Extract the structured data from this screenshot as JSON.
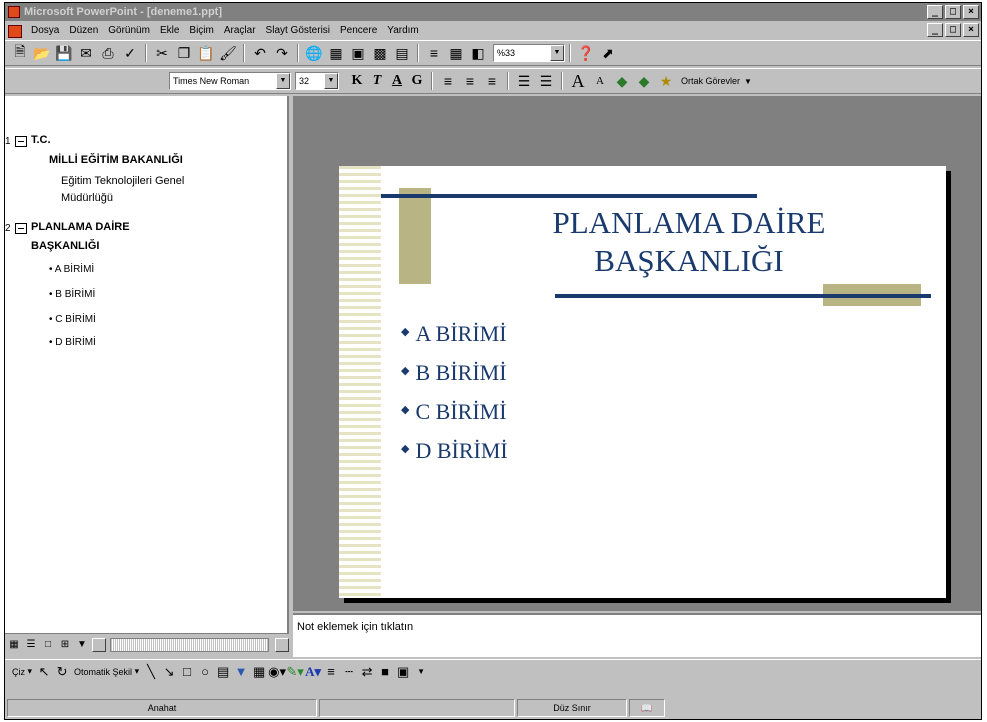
{
  "window": {
    "title": "Microsoft PowerPoint - [deneme1.ppt]",
    "minimize": "_",
    "restore": "ð",
    "close": "×"
  },
  "menu": [
    "Dosya",
    "Düzen",
    "Görünüm",
    "Ekle",
    "Biçim",
    "Araçlar",
    "Slayt Gösterisi",
    "Pencere",
    "Yardım"
  ],
  "toolbar": {
    "zoom": "%33",
    "font": "Times New Roman",
    "size": "32",
    "bold": "K",
    "italic": "T",
    "underline": "A",
    "shadow": "G",
    "tasks": "Ortak Görevler"
  },
  "outline": {
    "slides": [
      {
        "number": "1",
        "title1": "T.C.",
        "title2": "MİLLİ EĞİTİM BAKANLIĞI",
        "sub1": "Eğitim Teknolojileri Genel",
        "sub2": "Müdürlüğü"
      },
      {
        "number": "2",
        "title1": "PLANLAMA DAİRE",
        "title2": "BAŞKANLIĞI",
        "bullets": [
          "A BİRİMİ",
          "B BİRİMİ",
          "C BİRİMİ",
          "D BİRİMİ"
        ]
      }
    ]
  },
  "slide": {
    "title1": "PLANLAMA DAİRE",
    "title2": "BAŞKANLIĞI",
    "bullets": [
      "A BİRİMİ",
      "B BİRİMİ",
      "C BİRİMİ",
      "D BİRİMİ"
    ]
  },
  "notes": {
    "placeholder": "Not eklemek için tıklatın"
  },
  "drawing": {
    "draw_menu": "Çiz",
    "autoshapes": "Otomatik Şekil"
  },
  "status": {
    "outline_label": "Anahat",
    "design": "Düz Sınır"
  },
  "colors": {
    "title_blue": "#1a3a6e",
    "accent_olive": "#b8b484"
  }
}
